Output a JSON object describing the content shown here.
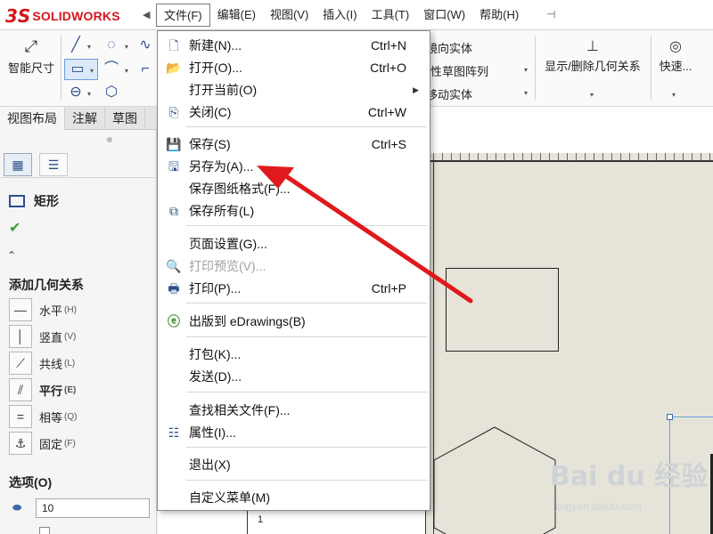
{
  "app": {
    "brand_mark": "3S",
    "brand_name": "SOLIDWORKS",
    "accent": "#d4161c"
  },
  "menubar": {
    "items": [
      {
        "label": "文件(F)",
        "active": true
      },
      {
        "label": "编辑(E)"
      },
      {
        "label": "视图(V)"
      },
      {
        "label": "插入(I)"
      },
      {
        "label": "工具(T)"
      },
      {
        "label": "窗口(W)"
      },
      {
        "label": "帮助(H)"
      }
    ]
  },
  "toolbar": {
    "smart_dim_label": "智能尺寸",
    "mirror_label": "镜向实体",
    "pattern_label": "线性草图阵列",
    "move_label": "移动实体",
    "relations_label": "显示/删除几何关系",
    "quick_label": "快速..."
  },
  "tabs": [
    {
      "label": "视图布局"
    },
    {
      "label": "注解"
    },
    {
      "label": "草图"
    }
  ],
  "panel": {
    "feature_title": "矩形",
    "add_relations_title": "添加几何关系",
    "relations": [
      {
        "label": "水平",
        "key": "(H)",
        "icon": "horizontal-icon"
      },
      {
        "label": "竖直",
        "key": "(V)",
        "icon": "vertical-icon"
      },
      {
        "label": "共线",
        "key": "(L)",
        "icon": "collinear-icon"
      },
      {
        "label": "平行",
        "key": "(E)",
        "icon": "parallel-icon",
        "bold": true
      },
      {
        "label": "相等",
        "key": "(Q)",
        "icon": "equal-icon"
      },
      {
        "label": "固定",
        "key": "(F)",
        "icon": "fix-icon"
      }
    ],
    "options_title": "选项(O)",
    "option_value": "10"
  },
  "file_menu": {
    "items": [
      {
        "label": "新建(N)...",
        "shortcut": "Ctrl+N",
        "icon": "new-document-icon"
      },
      {
        "label": "打开(O)...",
        "shortcut": "Ctrl+O",
        "icon": "open-folder-icon"
      },
      {
        "label": "打开当前(O)",
        "shortcut": "",
        "icon": "",
        "submenu": true
      },
      {
        "label": "关闭(C)",
        "shortcut": "Ctrl+W",
        "icon": "close-document-icon"
      },
      {
        "label": "保存(S)",
        "shortcut": "Ctrl+S",
        "icon": "save-icon"
      },
      {
        "label": "另存为(A)...",
        "shortcut": "",
        "icon": "save-as-icon"
      },
      {
        "label": "保存图纸格式(F)...",
        "shortcut": "",
        "icon": ""
      },
      {
        "label": "保存所有(L)",
        "shortcut": "",
        "icon": "save-all-icon"
      },
      {
        "label": "页面设置(G)...",
        "shortcut": "",
        "icon": ""
      },
      {
        "label": "打印预览(V)...",
        "shortcut": "",
        "icon": "print-preview-icon",
        "disabled": true
      },
      {
        "label": "打印(P)...",
        "shortcut": "Ctrl+P",
        "icon": "print-icon"
      },
      {
        "label": "出版到 eDrawings(B)",
        "shortcut": "",
        "icon": "edrawings-icon"
      },
      {
        "label": "打包(K)...",
        "shortcut": "",
        "icon": ""
      },
      {
        "label": "发送(D)...",
        "shortcut": "",
        "icon": ""
      },
      {
        "label": "查找相关文件(F)...",
        "shortcut": "",
        "icon": ""
      },
      {
        "label": "属性(I)...",
        "shortcut": "",
        "icon": "properties-icon"
      },
      {
        "label": "退出(X)",
        "shortcut": "",
        "icon": ""
      },
      {
        "label": "自定义菜单(M)",
        "shortcut": "",
        "icon": ""
      }
    ]
  },
  "watermark": {
    "text": "Bai du 经验",
    "sub": "jingyan.baidu.com"
  },
  "sheet_corner_label": "1",
  "annotation_color": "#e0191c"
}
